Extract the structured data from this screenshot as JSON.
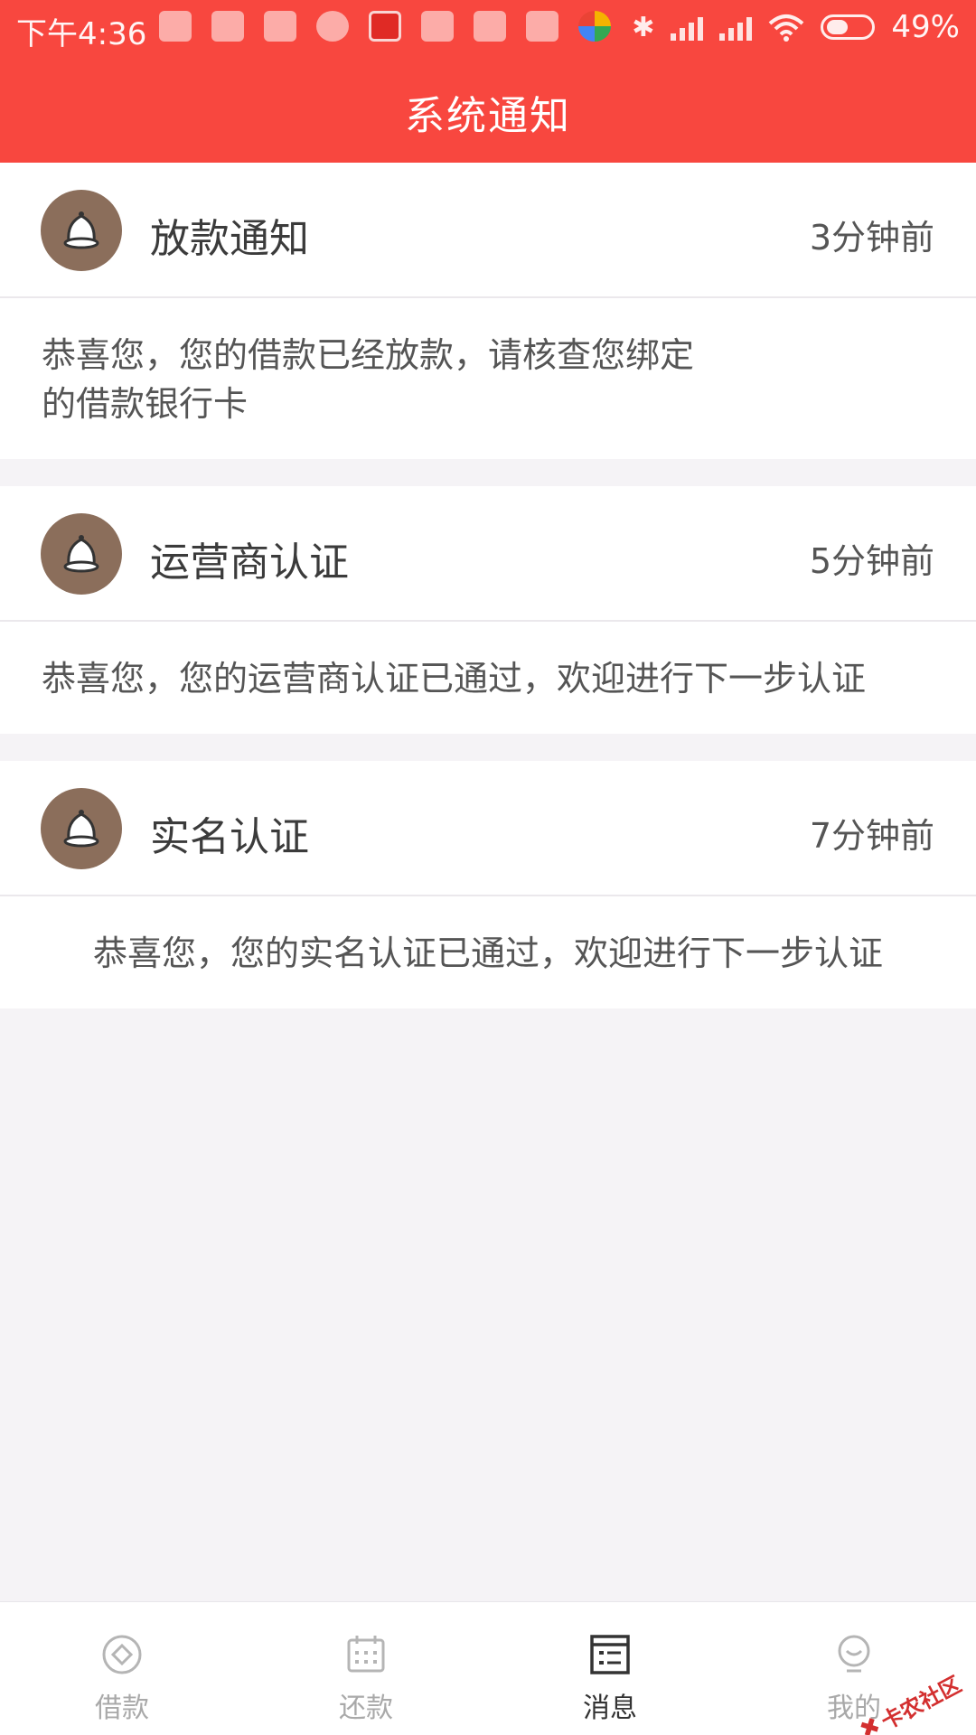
{
  "status_bar": {
    "time": "下午4:36",
    "battery": "49%",
    "battery_level": 0.49
  },
  "header": {
    "title": "系统通知"
  },
  "notifications": [
    {
      "title": "放款通知",
      "time": "3分钟前",
      "message_lines": [
        "恭喜您，您的借款已经放款，请核查您绑定",
        "的借款银行卡"
      ]
    },
    {
      "title": "运营商认证",
      "time": "5分钟前",
      "message_lines": [
        "恭喜您，您的运营商认证已通过，欢迎进行下一步认证"
      ]
    },
    {
      "title": "实名认证",
      "time": "7分钟前",
      "message_lines": [
        "恭喜您，您的实名认证已通过，欢迎进行下一步认证"
      ]
    }
  ],
  "tabs": [
    {
      "label": "借款",
      "icon": "loan-icon",
      "active": false
    },
    {
      "label": "还款",
      "icon": "calendar-icon",
      "active": false
    },
    {
      "label": "消息",
      "icon": "message-list-icon",
      "active": true
    },
    {
      "label": "我的",
      "icon": "profile-icon",
      "active": false
    }
  ],
  "watermark": {
    "text": "卡农社区"
  },
  "colors": {
    "brand_red": "#f8473f",
    "badge_brown": "#8b6e5b",
    "page_bg": "#f5f3f6"
  }
}
